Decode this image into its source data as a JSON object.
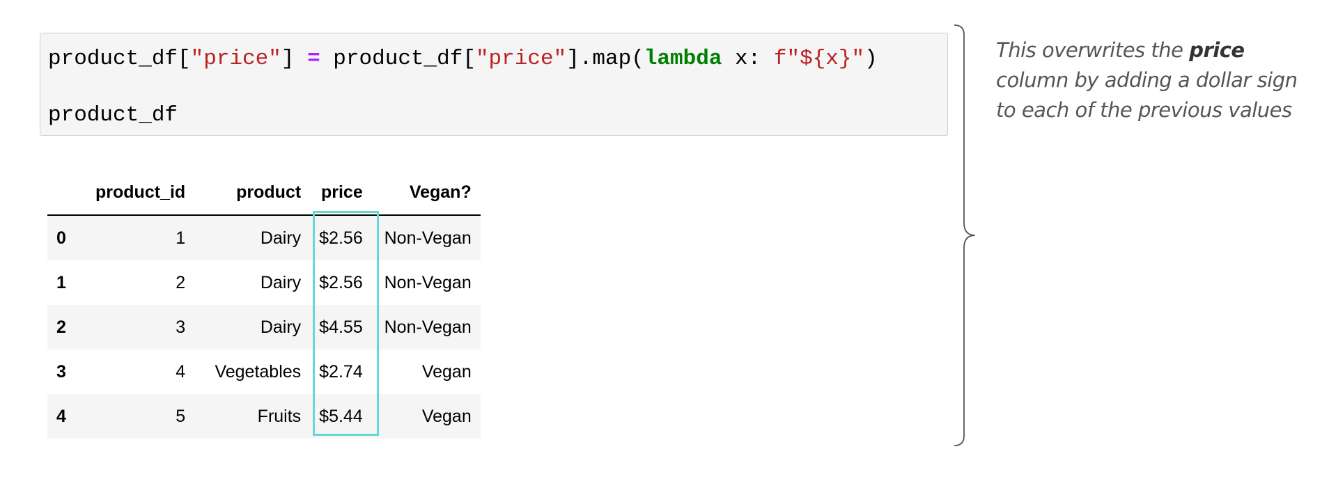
{
  "code": {
    "line1": {
      "tok1": "product_df[",
      "tok2": "\"price\"",
      "tok3": "] ",
      "tok4": "=",
      "tok5": " product_df[",
      "tok6": "\"price\"",
      "tok7": "].map(",
      "tok8": "lambda",
      "tok9": " x: ",
      "tok10": "f\"${x}\"",
      "tok11": ")"
    },
    "line2": "product_df"
  },
  "table": {
    "columns": [
      "",
      "product_id",
      "product",
      "price",
      "Vegan?"
    ],
    "rows": [
      {
        "index": "0",
        "product_id": "1",
        "product": "Dairy",
        "price": "$2.56",
        "vegan": "Non-Vegan"
      },
      {
        "index": "1",
        "product_id": "2",
        "product": "Dairy",
        "price": "$2.56",
        "vegan": "Non-Vegan"
      },
      {
        "index": "2",
        "product_id": "3",
        "product": "Dairy",
        "price": "$4.55",
        "vegan": "Non-Vegan"
      },
      {
        "index": "3",
        "product_id": "4",
        "product": "Vegetables",
        "price": "$2.74",
        "vegan": "Vegan"
      },
      {
        "index": "4",
        "product_id": "5",
        "product": "Fruits",
        "price": "$5.44",
        "vegan": "Vegan"
      }
    ]
  },
  "annotation": {
    "before": "This overwrites the ",
    "bold": "price",
    "after": " column by adding a dollar sign to each of the previous values"
  },
  "colors": {
    "highlight": "#64d8d3",
    "string": "#ba2121",
    "keyword": "#008000",
    "operator": "#aa22ff"
  }
}
